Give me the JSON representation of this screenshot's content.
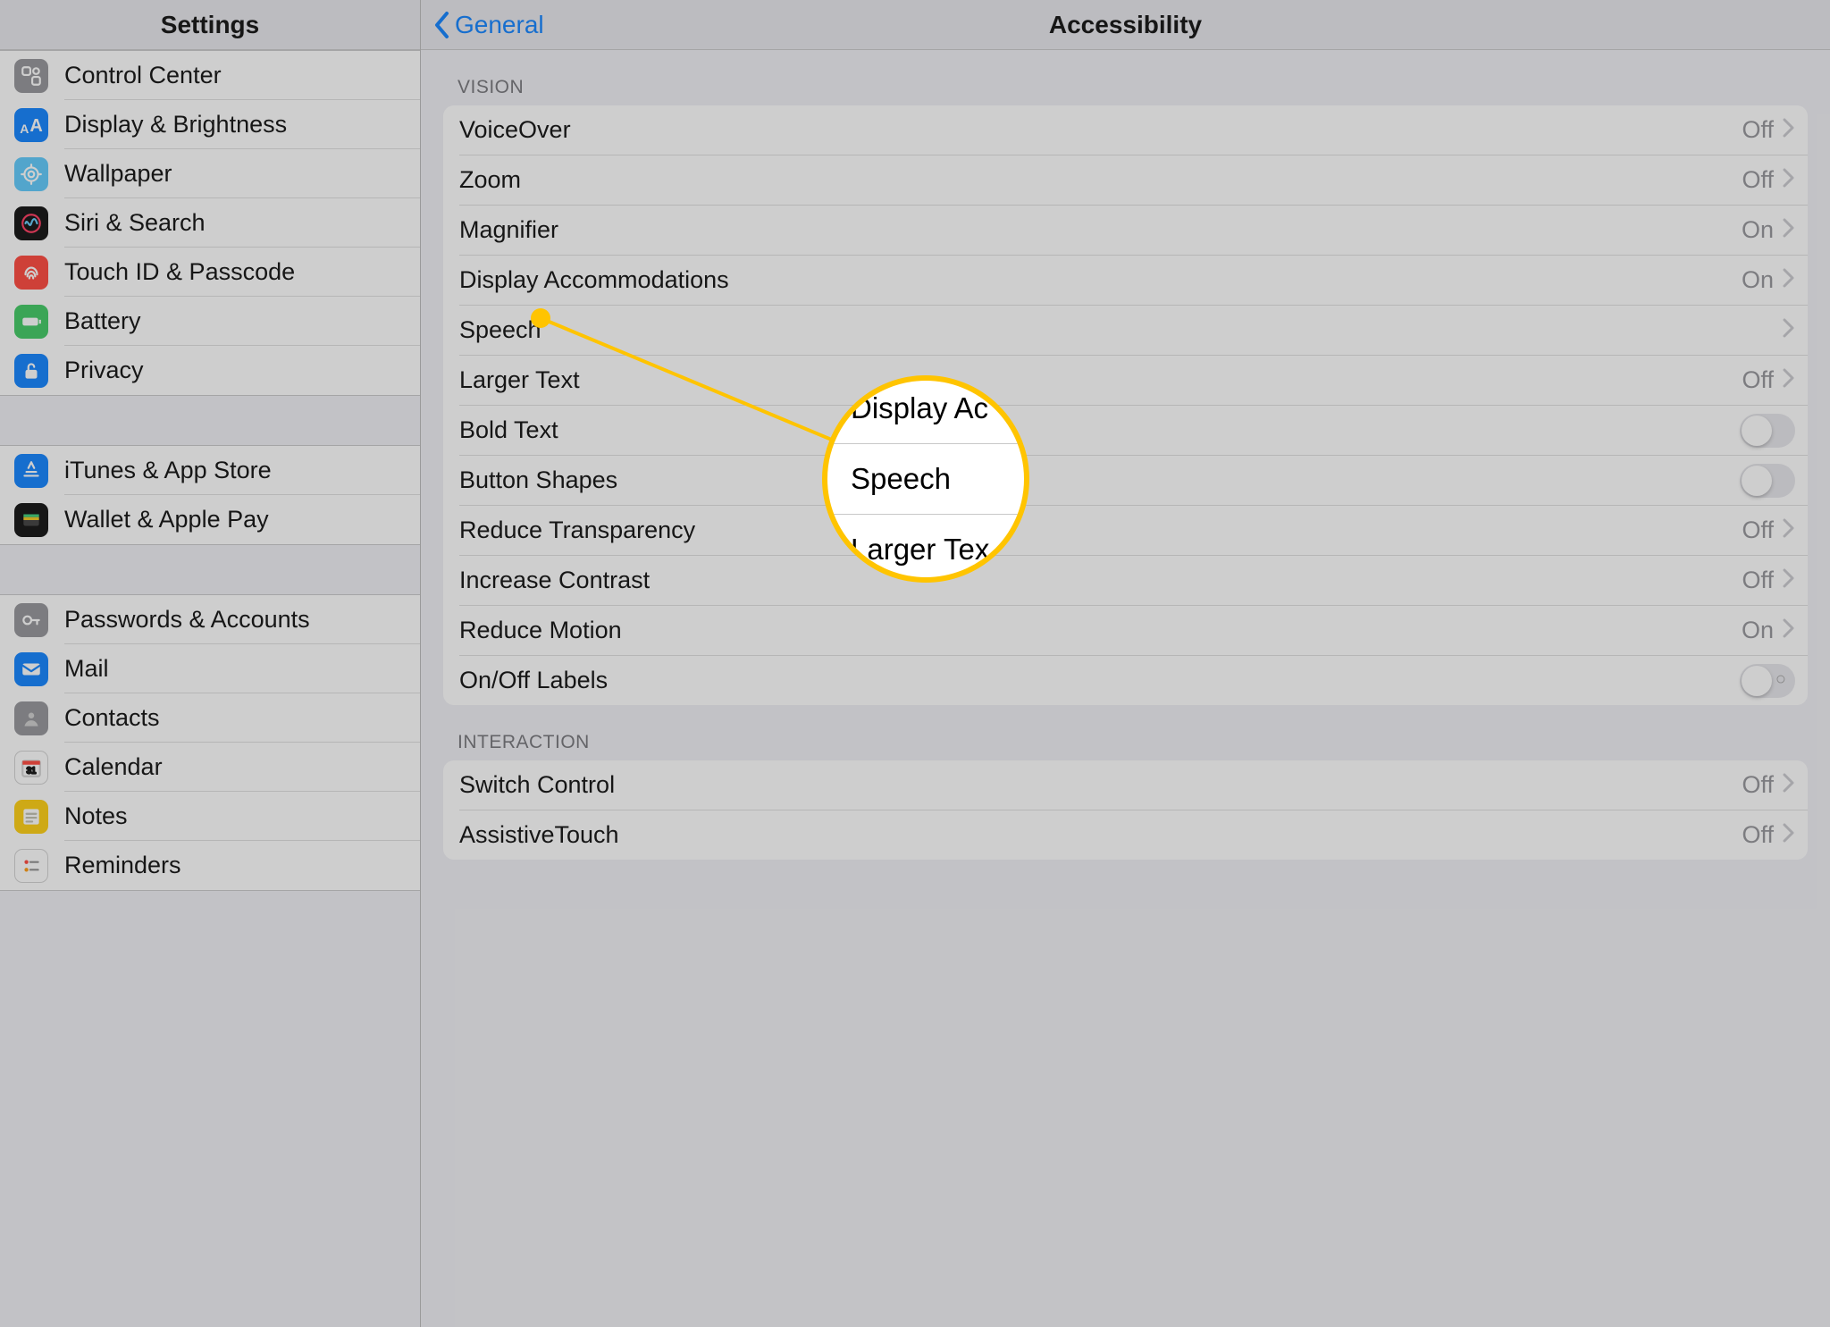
{
  "sidebar": {
    "title": "Settings",
    "groups": [
      [
        {
          "label": "Control Center",
          "icon": "control-center-icon",
          "bg": "bg-gray"
        },
        {
          "label": "Display & Brightness",
          "icon": "display-brightness-icon",
          "bg": "bg-blue"
        },
        {
          "label": "Wallpaper",
          "icon": "wallpaper-icon",
          "bg": "bg-cyan"
        },
        {
          "label": "Siri & Search",
          "icon": "siri-icon",
          "bg": "bg-black"
        },
        {
          "label": "Touch ID & Passcode",
          "icon": "touch-id-icon",
          "bg": "bg-red"
        },
        {
          "label": "Battery",
          "icon": "battery-icon",
          "bg": "bg-green"
        },
        {
          "label": "Privacy",
          "icon": "privacy-icon",
          "bg": "bg-blue"
        }
      ],
      [
        {
          "label": "iTunes & App Store",
          "icon": "app-store-icon",
          "bg": "bg-blue"
        },
        {
          "label": "Wallet & Apple Pay",
          "icon": "wallet-icon",
          "bg": "bg-black"
        }
      ],
      [
        {
          "label": "Passwords & Accounts",
          "icon": "passwords-icon",
          "bg": "bg-gray"
        },
        {
          "label": "Mail",
          "icon": "mail-icon",
          "bg": "bg-blue"
        },
        {
          "label": "Contacts",
          "icon": "contacts-icon",
          "bg": "bg-gray"
        },
        {
          "label": "Calendar",
          "icon": "calendar-icon",
          "bg": "bg-white"
        },
        {
          "label": "Notes",
          "icon": "notes-icon",
          "bg": "bg-yellow"
        },
        {
          "label": "Reminders",
          "icon": "reminders-icon",
          "bg": "bg-white"
        }
      ]
    ]
  },
  "detail": {
    "back_label": "General",
    "title": "Accessibility",
    "sections": [
      {
        "header": "Vision",
        "rows": [
          {
            "label": "VoiceOver",
            "status": "Off",
            "type": "nav"
          },
          {
            "label": "Zoom",
            "status": "Off",
            "type": "nav"
          },
          {
            "label": "Magnifier",
            "status": "On",
            "type": "nav"
          },
          {
            "label": "Display Accommodations",
            "status": "On",
            "type": "nav"
          },
          {
            "label": "Speech",
            "status": "",
            "type": "nav"
          },
          {
            "label": "Larger Text",
            "status": "Off",
            "type": "nav"
          },
          {
            "label": "Bold Text",
            "status": "",
            "type": "switch"
          },
          {
            "label": "Button Shapes",
            "status": "",
            "type": "switch"
          },
          {
            "label": "Reduce Transparency",
            "status": "Off",
            "type": "nav"
          },
          {
            "label": "Increase Contrast",
            "status": "Off",
            "type": "nav"
          },
          {
            "label": "Reduce Motion",
            "status": "On",
            "type": "nav"
          },
          {
            "label": "On/Off Labels",
            "status": "",
            "type": "switch-labels"
          }
        ]
      },
      {
        "header": "Interaction",
        "rows": [
          {
            "label": "Switch Control",
            "status": "Off",
            "type": "nav"
          },
          {
            "label": "AssistiveTouch",
            "status": "Off",
            "type": "nav"
          }
        ]
      }
    ]
  },
  "callout": {
    "rows": [
      "Display Ac",
      "Speech",
      "Larger Tex"
    ]
  }
}
